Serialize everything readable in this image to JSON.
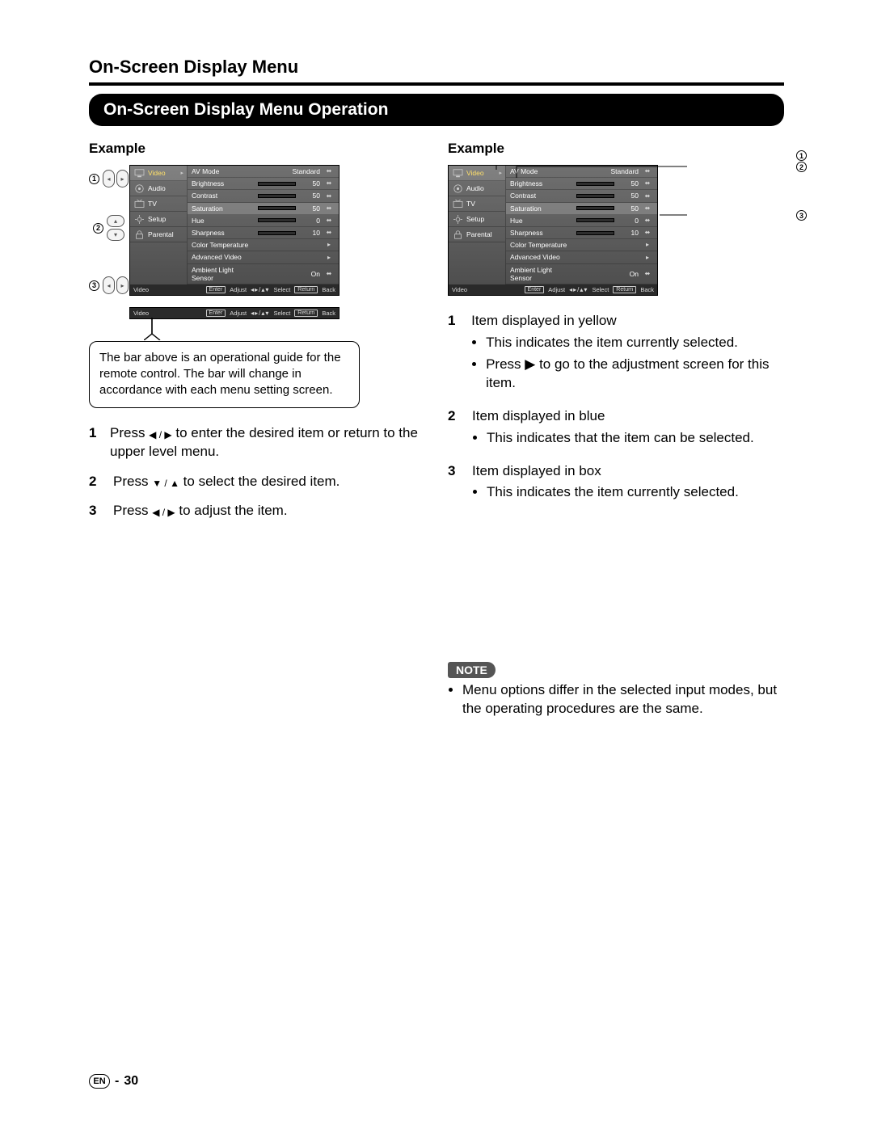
{
  "page_title": "On-Screen Display Menu",
  "section_title": "On-Screen Display Menu Operation",
  "example_label": "Example",
  "osd": {
    "nav": [
      {
        "label": "Video",
        "icon": "monitor",
        "selected": true
      },
      {
        "label": "Audio",
        "icon": "speaker"
      },
      {
        "label": "TV",
        "icon": "tv"
      },
      {
        "label": "Setup",
        "icon": "gear"
      },
      {
        "label": "Parental",
        "icon": "lock"
      }
    ],
    "options": [
      {
        "label": "AV Mode",
        "value": "Standard",
        "type": "select"
      },
      {
        "label": "Brightness",
        "value": "50",
        "type": "slider",
        "fill": 50
      },
      {
        "label": "Contrast",
        "value": "50",
        "type": "slider",
        "fill": 50
      },
      {
        "label": "Saturation",
        "value": "50",
        "type": "slider",
        "fill": 50,
        "highlight": true
      },
      {
        "label": "Hue",
        "value": "0",
        "type": "slider",
        "fill": 50
      },
      {
        "label": "Sharpness",
        "value": "10",
        "type": "slider",
        "fill": 40
      },
      {
        "label": "Color Temperature",
        "type": "enter"
      },
      {
        "label": "Advanced Video",
        "type": "enter"
      },
      {
        "label": "Ambient Light Sensor",
        "value": "On",
        "type": "select"
      }
    ],
    "bottom": {
      "crumb": "Video",
      "enter": "Enter",
      "adjust": "Adjust",
      "select": "Select",
      "return": "Return",
      "back": "Back"
    }
  },
  "callout_box": "The bar above is an operational guide for the remote control. The bar will change in accordance with each menu setting screen.",
  "left_steps": [
    {
      "n": "1",
      "pre": "Press ",
      "glyph": "◀ / ▶",
      "post": "  to enter the desired item or return to the upper level menu."
    },
    {
      "n": "2",
      "pre": "Press ",
      "glyph": "▼ / ▲",
      "post": "  to select the desired item."
    },
    {
      "n": "3",
      "pre": "Press ",
      "glyph": "◀ / ▶",
      "post": "  to adjust the item."
    }
  ],
  "right_steps": [
    {
      "n": "1",
      "head": "Item displayed in yellow",
      "bullets": [
        "This indicates the item currently selected.",
        "Press  ▶  to go to the adjustment screen for this item."
      ]
    },
    {
      "n": "2",
      "head": "Item displayed in blue",
      "bullets": [
        "This indicates that the item can be selected."
      ]
    },
    {
      "n": "3",
      "head": "Item displayed in box",
      "bullets": [
        "This indicates the item currently selected."
      ]
    }
  ],
  "note_label": "NOTE",
  "note_text": "Menu options differ in the selected input modes, but the operating procedures are the same.",
  "footer": {
    "lang": "EN",
    "sep": "-",
    "page": "30"
  }
}
